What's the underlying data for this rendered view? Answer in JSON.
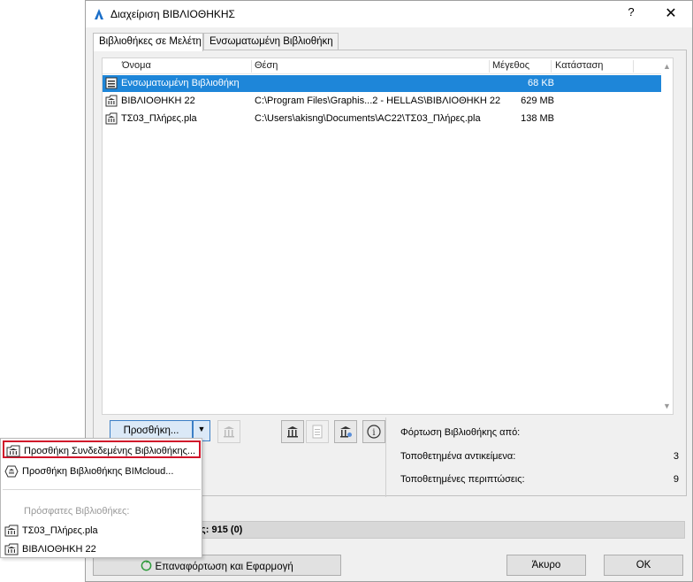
{
  "window": {
    "title": "Διαχείριση ΒΙΒΛΙΟΘΗΚΗΣ",
    "help": "?",
    "close": "✕"
  },
  "tabs": [
    {
      "label": "Βιβλιοθήκες σε Μελέτη",
      "active": true
    },
    {
      "label": "Ενσωματωμένη Βιβλιοθήκη",
      "active": false
    }
  ],
  "list": {
    "columns": [
      "Όνομα",
      "Θέση",
      "Μέγεθος",
      "Κατάσταση"
    ],
    "rows": [
      {
        "name": "Ενσωματωμένη Βιβλιοθήκη",
        "path": "",
        "size": "68 KB",
        "status": "",
        "selected": true,
        "icon": "embedded-library-icon"
      },
      {
        "name": "ΒΙΒΛΙΟΘΗΚΗ 22",
        "path": "C:\\Program Files\\Graphis...2 - HELLAS\\ΒΙΒΛΙΟΘΗΚΗ 22",
        "size": "629 MB",
        "status": "",
        "selected": false,
        "icon": "linked-library-icon"
      },
      {
        "name": "ΤΣ03_Πλήρες.pla",
        "path": "C:\\Users\\akisng\\Documents\\AC22\\ΤΣ03_Πλήρες.pla",
        "size": "138 MB",
        "status": "",
        "selected": false,
        "icon": "linked-library-icon"
      }
    ]
  },
  "toolbar": {
    "add_label": "Προσθήκη...",
    "dropdown_arrow": "▼",
    "info_glyph": "i"
  },
  "info": {
    "load_from": "Φόρτωση Βιβλιοθήκης από:",
    "placed_objects_label": "Τοποθετημένα αντικείμενα:",
    "placed_objects_value": "3",
    "placed_instances_label": "Τοποθετημένες περιπτώσεις:",
    "placed_instances_value": "9"
  },
  "status": {
    "text": "ις: 915 (0)"
  },
  "buttons": {
    "reload": "Επαναφόρτωση και Εφαρμογή",
    "cancel": "Άκυρο",
    "ok": "OK"
  },
  "menu": {
    "items": [
      {
        "label": "Προσθήκη Συνδεδεμένης Βιβλιοθήκης...",
        "highlighted": true
      },
      {
        "label": "Προσθήκη Βιβλιοθήκης BIMcloud...",
        "highlighted": false
      }
    ],
    "recent_heading": "Πρόσφατες Βιβλιοθήκες:",
    "recent": [
      "ΤΣ03_Πλήρες.pla",
      "ΒΙΒΛΙΟΘΗΚΗ 22"
    ]
  },
  "colors": {
    "selection": "#1e86d9",
    "highlight_border": "#d0152a",
    "accent": "#3c7fc6"
  }
}
